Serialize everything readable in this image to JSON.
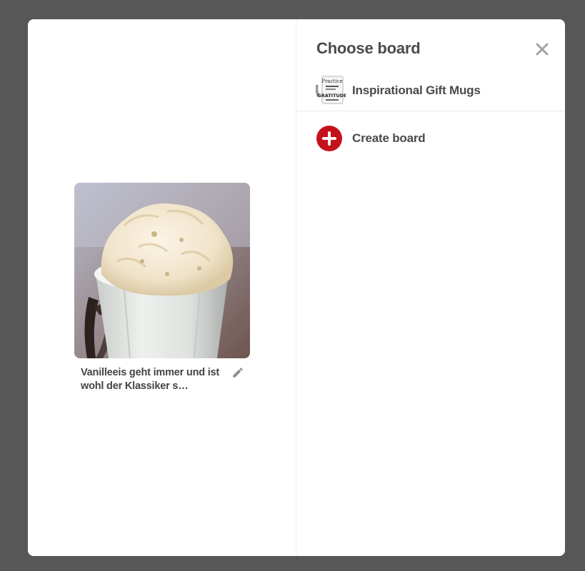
{
  "dialog": {
    "title": "Choose board",
    "close_icon": "close-icon"
  },
  "pin": {
    "image_icon": "vanilla-ice-cream-photo",
    "description": "Vanilleeis geht immer und ist wohl der Klassiker s…",
    "edit_icon": "pencil-icon"
  },
  "boards": [
    {
      "name": "Inspirational Gift Mugs",
      "thumb_icon": "mug-thumbnail",
      "thumb_text": [
        "Practice",
        "GRATITUDE"
      ]
    }
  ],
  "create_board": {
    "label": "Create board",
    "icon": "plus-circle-icon",
    "color": "#c4121c"
  },
  "colors": {
    "backdrop": "#575757",
    "text": "#4a4a4a",
    "accent": "#c4121c"
  }
}
